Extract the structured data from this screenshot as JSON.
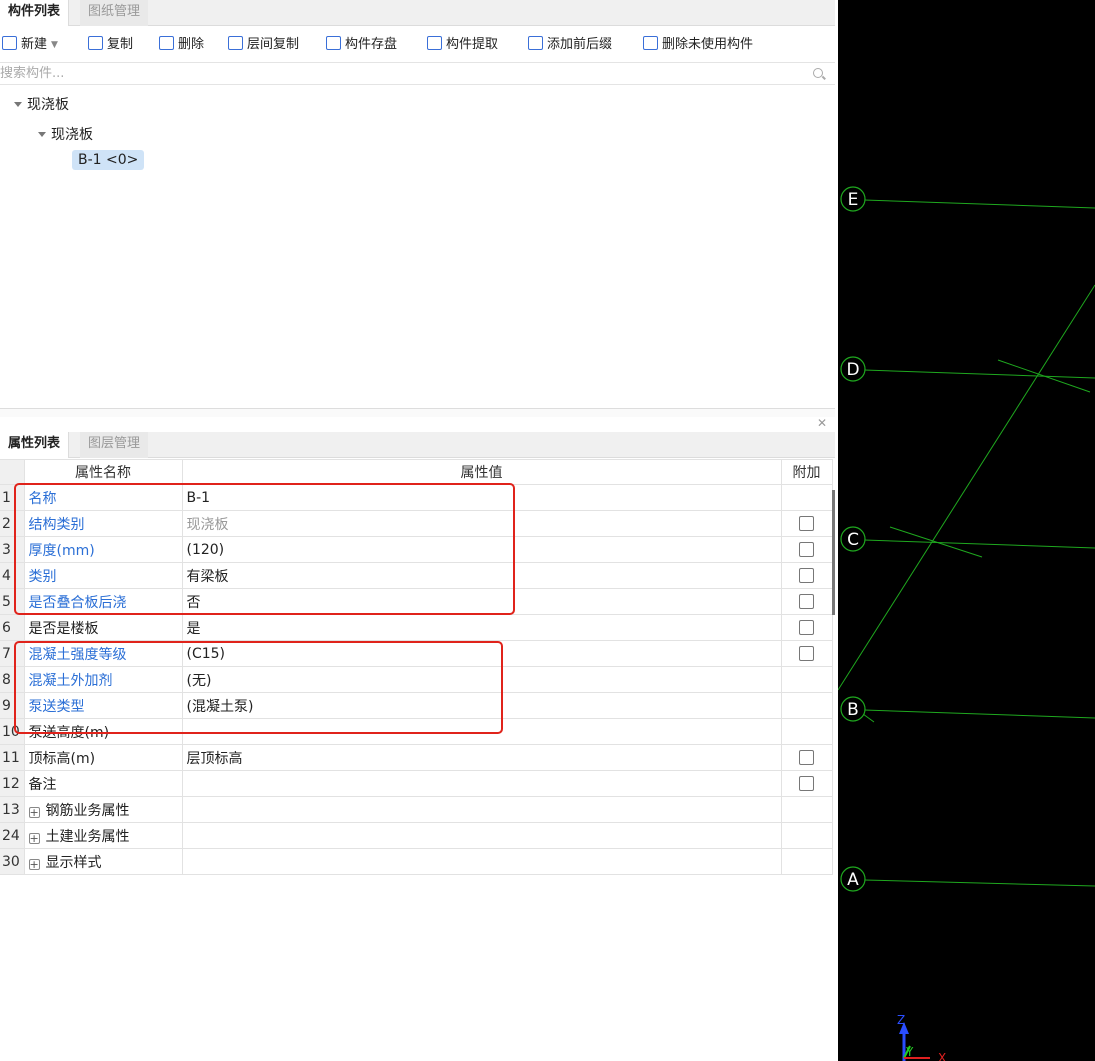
{
  "top_tabs": [
    "构件列表",
    "图纸管理"
  ],
  "toolbar": {
    "new": "新建",
    "copy": "复制",
    "delete": "删除",
    "floor_copy": "层间复制",
    "save_component": "构件存盘",
    "extract_component": "构件提取",
    "add_prefix_suffix": "添加前后缀",
    "delete_unused": "删除未使用构件"
  },
  "search": {
    "placeholder": "搜索构件..."
  },
  "tree": {
    "root": "现浇板",
    "child": "现浇板",
    "leaf": "B-1 <0>"
  },
  "prop_tabs": [
    "属性列表",
    "图层管理"
  ],
  "prop_headers": {
    "name": "属性名称",
    "value": "属性值",
    "extra": "附加"
  },
  "properties": [
    {
      "num": "1",
      "name": "名称",
      "value": "B-1"
    },
    {
      "num": "2",
      "name": "结构类别",
      "value": "现浇板"
    },
    {
      "num": "3",
      "name": "厚度(mm)",
      "value": "(120)"
    },
    {
      "num": "4",
      "name": "类别",
      "value": "有梁板"
    },
    {
      "num": "5",
      "name": "是否叠合板后浇",
      "value": "否"
    },
    {
      "num": "6",
      "name": "是否是楼板",
      "value": "是"
    },
    {
      "num": "7",
      "name": "混凝土强度等级",
      "value": "(C15)"
    },
    {
      "num": "8",
      "name": "混凝土外加剂",
      "value": "(无)"
    },
    {
      "num": "9",
      "name": "泵送类型",
      "value": "(混凝土泵)"
    },
    {
      "num": "10",
      "name": "泵送高度(m)",
      "value": ""
    },
    {
      "num": "11",
      "name": "顶标高(m)",
      "value": "层顶标高"
    },
    {
      "num": "12",
      "name": "备注",
      "value": ""
    },
    {
      "num": "13",
      "name": "钢筋业务属性",
      "value": ""
    },
    {
      "num": "24",
      "name": "土建业务属性",
      "value": ""
    },
    {
      "num": "30",
      "name": "显示样式",
      "value": ""
    }
  ],
  "viewport": {
    "axis_labels": [
      "E",
      "D",
      "C",
      "B",
      "A"
    ],
    "coord_axes": [
      "Z",
      "Y",
      "X"
    ],
    "colors": {
      "background": "#000000",
      "grid_line": "#1fa81f",
      "label_bg": "#000000"
    }
  },
  "colors": {
    "highlight_box": "#e0231b",
    "link_blue": "#2b6fd6",
    "tree_selected": "#cfe3f7"
  }
}
